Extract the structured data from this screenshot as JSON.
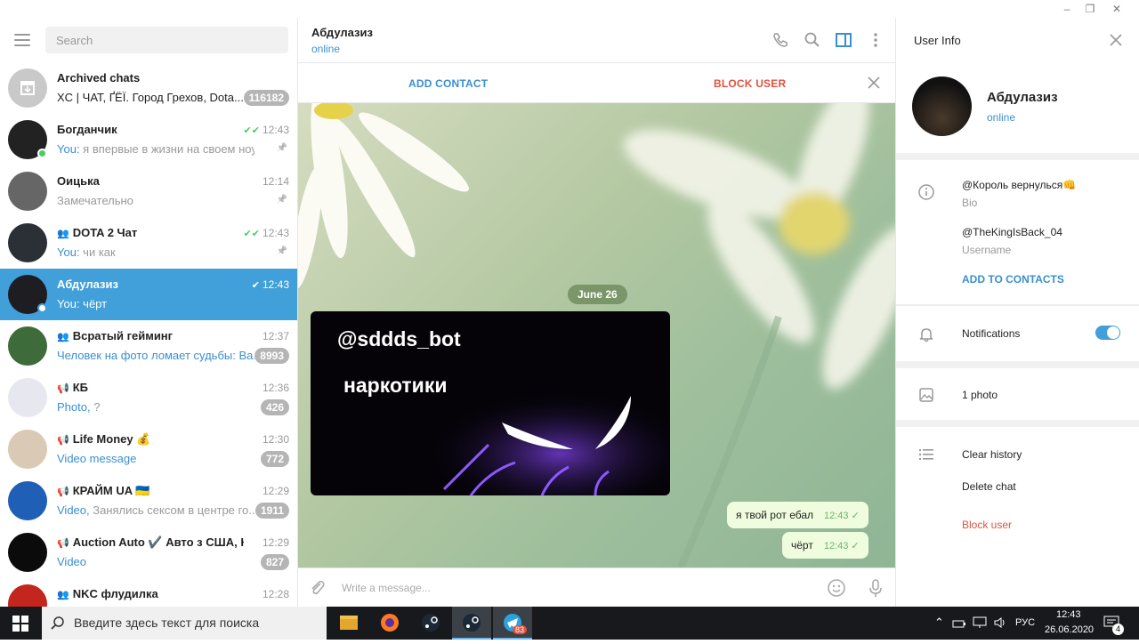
{
  "window": {
    "controls": [
      "–",
      "❐",
      "✕"
    ]
  },
  "left": {
    "search_placeholder": "Search",
    "chats": [
      {
        "name": "Archived chats",
        "time": "",
        "prefix": "",
        "preview": "XC | ЧАТ, ҐЁЇ. Город Грехов, Dota...",
        "badge": "116182",
        "pinned": false,
        "check": "",
        "group": "",
        "avatar": "#c9c9c9"
      },
      {
        "name": "Богданчик",
        "time": "12:43",
        "prefix": "You:",
        "preview": " я впервые в жизни на своем ноуте",
        "badge": "",
        "pinned": true,
        "check": "✔✔",
        "group": "",
        "avatar": "#222",
        "online": true
      },
      {
        "name": "Оицька",
        "time": "12:14",
        "prefix": "",
        "preview": "Замечательно",
        "badge": "",
        "pinned": true,
        "check": "",
        "group": "",
        "avatar": "#666"
      },
      {
        "name": "DOTA 2 Чат",
        "time": "12:43",
        "prefix": "You:",
        "preview": " чи как",
        "badge": "",
        "pinned": true,
        "check": "✔✔",
        "group": "👥",
        "avatar": "#2b2f36"
      },
      {
        "name": "Абдулазиз",
        "time": "12:43",
        "prefix": "You:",
        "preview": " чёрт",
        "badge": "",
        "pinned": false,
        "check": "✔",
        "group": "",
        "avatar": "#1e1e22",
        "active": true,
        "online": true
      },
      {
        "name": "Всратый гейминг",
        "time": "12:37",
        "prefix": "",
        "preview": "Человек на фото ломает судьбы: Ва...",
        "badge": "8993",
        "pinned": false,
        "check": "",
        "group": "👥",
        "avatar": "#3e6b3a",
        "hl_preview": true
      },
      {
        "name": "КБ",
        "time": "12:36",
        "prefix": "Photo,",
        "preview": " ?",
        "badge": "426",
        "pinned": false,
        "check": "",
        "group": "📢",
        "avatar": "#e7e7f0"
      },
      {
        "name": "Life Money 💰",
        "time": "12:30",
        "prefix": "Video message",
        "preview": "",
        "badge": "772",
        "pinned": false,
        "check": "",
        "group": "📢",
        "avatar": "#d9c9b5"
      },
      {
        "name": "КРАЙМ UA 🇺🇦",
        "time": "12:29",
        "prefix": "Video,",
        "preview": " Занялись сексом  в центре го...",
        "badge": "1911",
        "pinned": false,
        "check": "",
        "group": "📢",
        "avatar": "#1f5fb5"
      },
      {
        "name": "Auction Auto ✔️ Авто з США, Ка...",
        "time": "12:29",
        "prefix": "Video",
        "preview": "",
        "badge": "827",
        "pinned": false,
        "check": "",
        "group": "📢",
        "avatar": "#0b0b0b"
      },
      {
        "name": "NKC флудилка",
        "time": "12:28",
        "prefix": "",
        "preview": "",
        "badge": "",
        "pinned": false,
        "check": "",
        "group": "👥",
        "avatar": "#c2261d"
      }
    ]
  },
  "chat": {
    "name": "Абдулазиз",
    "status": "online",
    "add_contact": "ADD CONTACT",
    "block_user": "BLOCK USER",
    "date": "June 26",
    "image_line1": "@sddds_bot",
    "image_line2": "наркотики",
    "messages": [
      {
        "text": "я твой рот ебал",
        "time": "12:43"
      },
      {
        "text": "чёрт",
        "time": "12:43"
      }
    ],
    "composer_placeholder": "Write a message..."
  },
  "info": {
    "title": "User Info",
    "name": "Абдулазиз",
    "status": "online",
    "bio": "@Король вернулься👊",
    "bio_label": "Bio",
    "username": "@TheKingIsBack_04",
    "username_label": "Username",
    "add_to_contacts": "ADD TO CONTACTS",
    "notifications": "Notifications",
    "notifications_on": true,
    "photos": "1 photo",
    "clear_history": "Clear history",
    "delete_chat": "Delete chat",
    "block_user": "Block user"
  },
  "taskbar": {
    "search_text": "Введите здесь текст для поиска",
    "lang": "РУС",
    "time": "12:43",
    "date": "26.06.2020",
    "notif_count": "4",
    "telegram_badge": "83"
  },
  "colors": {
    "accent": "#419fd9",
    "link": "#3a8fd0",
    "danger": "#e0533f",
    "bubble": "#effdde"
  }
}
